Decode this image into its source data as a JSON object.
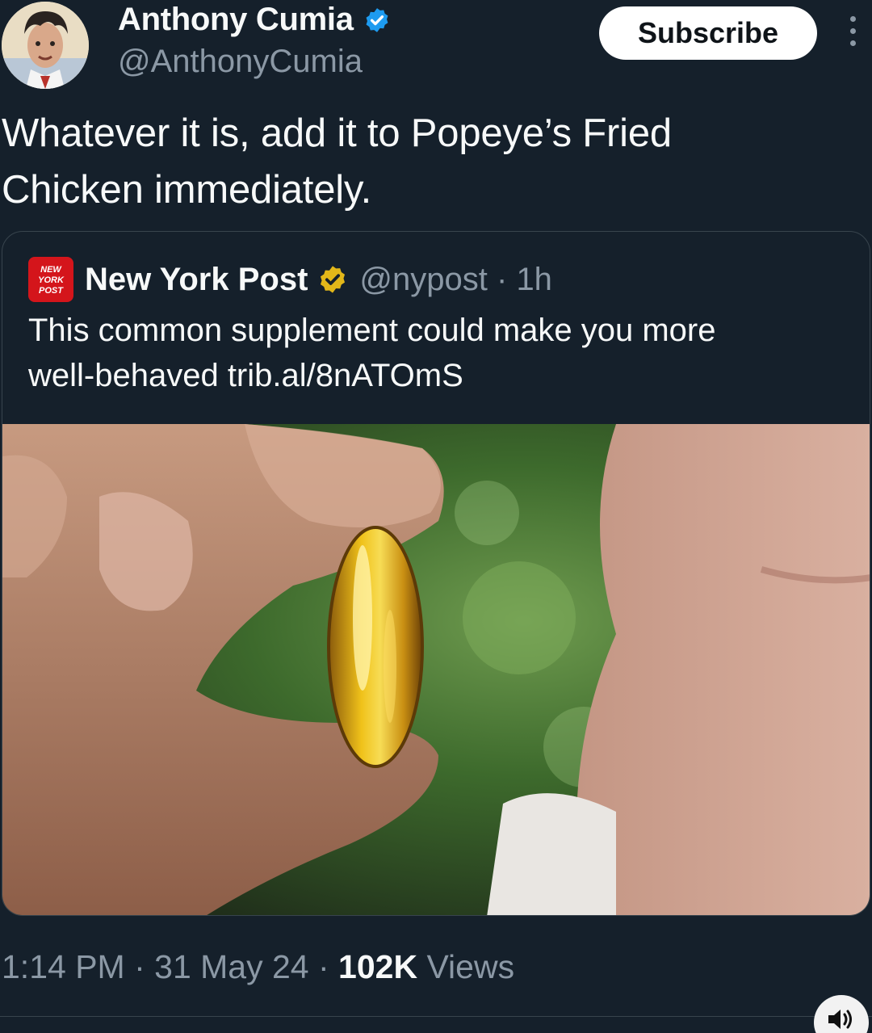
{
  "author": {
    "name": "Anthony Cumia",
    "handle": "@AnthonyCumia",
    "avatar_icon": "caricature-avatar-icon",
    "verified_color": "#1d9bf0"
  },
  "actions": {
    "subscribe_label": "Subscribe",
    "more_icon": "more-vertical-icon"
  },
  "tweet": {
    "text_line1": "Whatever it is, add it to Popeye’s Fried",
    "text_line2": "Chicken immediately."
  },
  "quoted": {
    "logo_text_1": "NEW",
    "logo_text_2": "YORK",
    "logo_text_3": "POST",
    "name": "New York Post",
    "badge_color": "#e2b719",
    "handle": "@nypost",
    "separator": "·",
    "age": "1h",
    "text_line1": "This common supplement could make you more",
    "text_line2": "well-behaved trib.al/8nATOmS",
    "image_icon": "fish-oil-capsule-photo"
  },
  "footer": {
    "time": "1:14 PM",
    "sep1": " · ",
    "date": "31 May 24",
    "sep2": " · ",
    "views_count": "102K",
    "views_label": " Views"
  },
  "controls": {
    "sound_icon": "speaker-icon"
  }
}
